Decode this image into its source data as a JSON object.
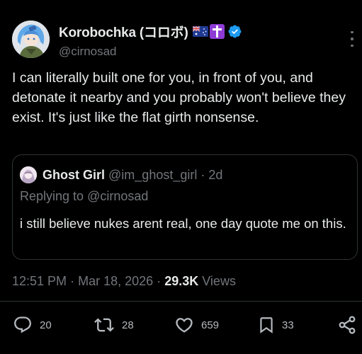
{
  "author": {
    "display_name": "Korobochka (コロボ)",
    "handle": "@cirnosad",
    "avatar_icon": "anime-character-avatar",
    "flag_icon": "australia-flag-icon",
    "emoji_icon": "latin-cross-emoji",
    "verified_icon": "verified-badge-icon"
  },
  "tweet": {
    "text": "I can literally built one for you, in front of you, and detonate it nearby and you probably won't believe they exist. It's just like the flat girth nonsense."
  },
  "quote": {
    "name": "Ghost Girl",
    "handle": "@im_ghost_girl",
    "separator": "·",
    "time": "2d",
    "replying_prefix": "Replying to",
    "replying_to": "@cirnosad",
    "text": "i still believe nukes arent real, one day quote me on this."
  },
  "meta": {
    "time": "12:51 PM",
    "separator": "·",
    "date": "Mar 18, 2026",
    "views_count": "29.3K",
    "views_label": "Views"
  },
  "actions": {
    "replies": "20",
    "reposts": "28",
    "likes": "659",
    "bookmarks": "33"
  },
  "colors": {
    "background": "#000000",
    "text_primary": "#e7e9ea",
    "text_secondary": "#71767b",
    "verified": "#1d9bf0",
    "border": "#2f3336"
  }
}
